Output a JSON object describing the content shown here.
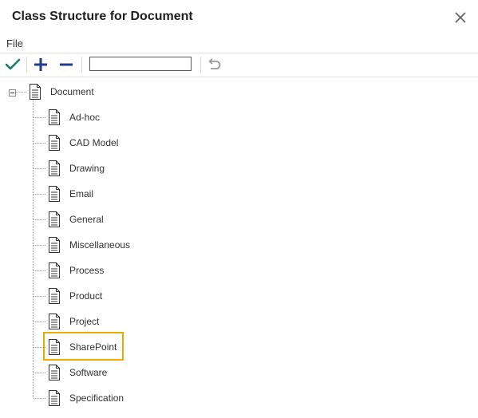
{
  "window": {
    "title": "Class Structure for Document"
  },
  "menu": {
    "file_label": "File"
  },
  "toolbar": {
    "search_value": ""
  },
  "tree": {
    "root": {
      "label": "Document"
    },
    "children": [
      {
        "label": "Ad-hoc"
      },
      {
        "label": "CAD Model"
      },
      {
        "label": "Drawing"
      },
      {
        "label": "Email"
      },
      {
        "label": "General"
      },
      {
        "label": "Miscellaneous"
      },
      {
        "label": "Process"
      },
      {
        "label": "Product"
      },
      {
        "label": "Project"
      },
      {
        "label": "SharePoint"
      },
      {
        "label": "Software"
      },
      {
        "label": "Specification"
      }
    ],
    "selected": "SharePoint"
  },
  "colors": {
    "accept": "#1a7a6c",
    "add_remove": "#1f3a93",
    "undo": "#9a9a9a",
    "highlight": "#f0a800"
  },
  "icons": {
    "close": "close-icon",
    "accept": "checkmark-icon",
    "add": "plus-icon",
    "remove": "minus-icon",
    "undo": "undo-icon",
    "node": "document-icon",
    "expander": "collapse-icon"
  }
}
